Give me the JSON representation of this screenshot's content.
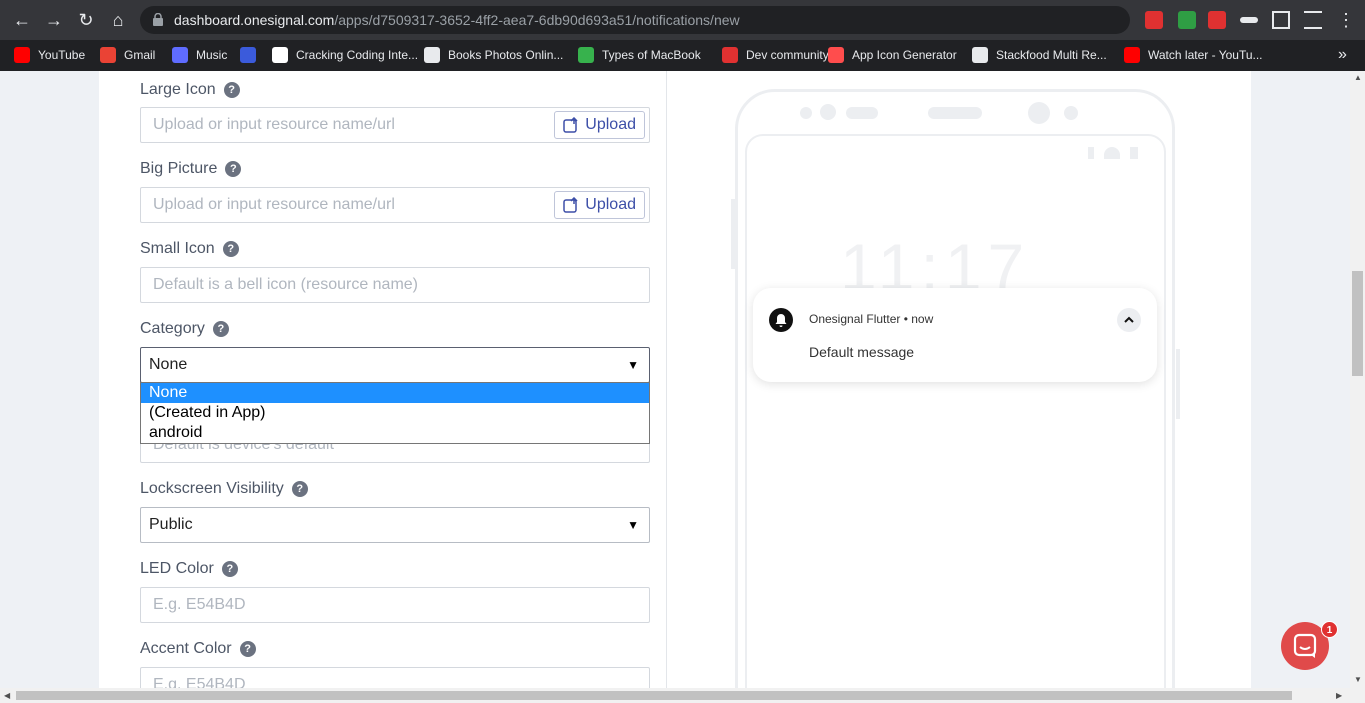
{
  "browser": {
    "url_host": "dashboard.onesignal.com",
    "url_path": "/apps/d7509317-3652-4ff2-aea7-6db90d693a51/notifications/new",
    "bookmarks": [
      {
        "label": "YouTube",
        "color": "#ff0000"
      },
      {
        "label": "Gmail",
        "color": "#ea4335"
      },
      {
        "label": "Music",
        "color": "#5f6cff"
      },
      {
        "label": "",
        "color": "#3b5bdb"
      },
      {
        "label": "Cracking Coding Inte...",
        "color": "#ffffff"
      },
      {
        "label": "Books Photos Onlin...",
        "color": "#e8eaed"
      },
      {
        "label": "Types of MacBook",
        "color": "#37b24d"
      },
      {
        "label": "Dev community",
        "color": "#e03131"
      },
      {
        "label": "App Icon Generator",
        "color": "#ff4d4d"
      },
      {
        "label": "Stackfood Multi Re...",
        "color": "#e8eaed"
      },
      {
        "label": "Watch later - YouTu...",
        "color": "#ff0000"
      }
    ],
    "more_label": "»"
  },
  "form": {
    "large_icon": {
      "label": "Large Icon",
      "placeholder": "Upload or input resource name/url",
      "upload_label": "Upload"
    },
    "big_picture": {
      "label": "Big Picture",
      "placeholder": "Upload or input resource name/url",
      "upload_label": "Upload"
    },
    "small_icon": {
      "label": "Small Icon",
      "placeholder": "Default is a bell icon (resource name)"
    },
    "category": {
      "label": "Category",
      "value": "None",
      "options": [
        "None",
        "(Created in App)",
        "android"
      ],
      "selected_index": 0
    },
    "sound": {
      "placeholder": "Default is device's default"
    },
    "lockscreen": {
      "label": "Lockscreen Visibility",
      "value": "Public"
    },
    "led_color": {
      "label": "LED Color",
      "placeholder": "E.g. E54B4D"
    },
    "accent_color": {
      "label": "Accent Color",
      "placeholder": "E.g. E54B4D"
    },
    "help_glyph": "?"
  },
  "preview": {
    "clock": "11:17",
    "app_line": "Onesignal Flutter • now",
    "message": "Default message"
  },
  "chat": {
    "badge_count": "1"
  },
  "colors": {
    "accent": "#3d4fa8",
    "select_highlight": "#1e90ff",
    "chat": "#e04a4a"
  }
}
